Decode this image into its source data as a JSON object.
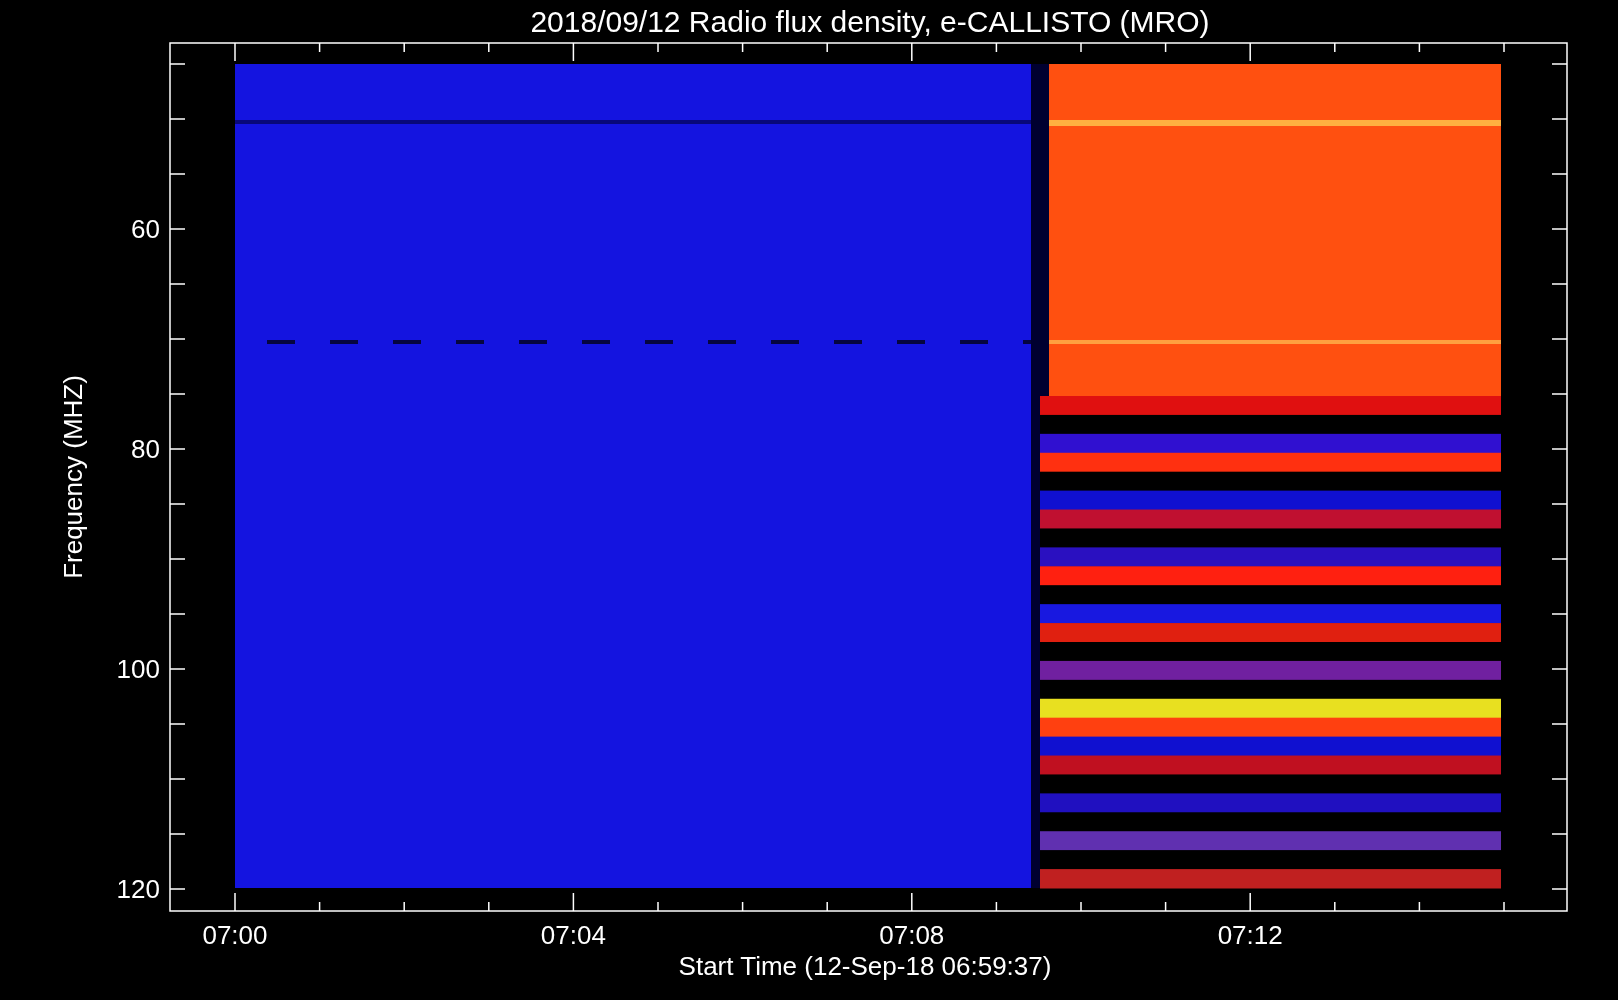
{
  "title": "2018/09/12  Radio flux density, e-CALLISTO (MRO)",
  "ylabel": "Frequency (MHZ)",
  "xlabel": "Start Time (12-Sep-18 06:59:37)",
  "yticks": [
    "60",
    "80",
    "100",
    "120"
  ],
  "xticks": [
    "07:00",
    "07:04",
    "07:08",
    "07:12"
  ]
}
